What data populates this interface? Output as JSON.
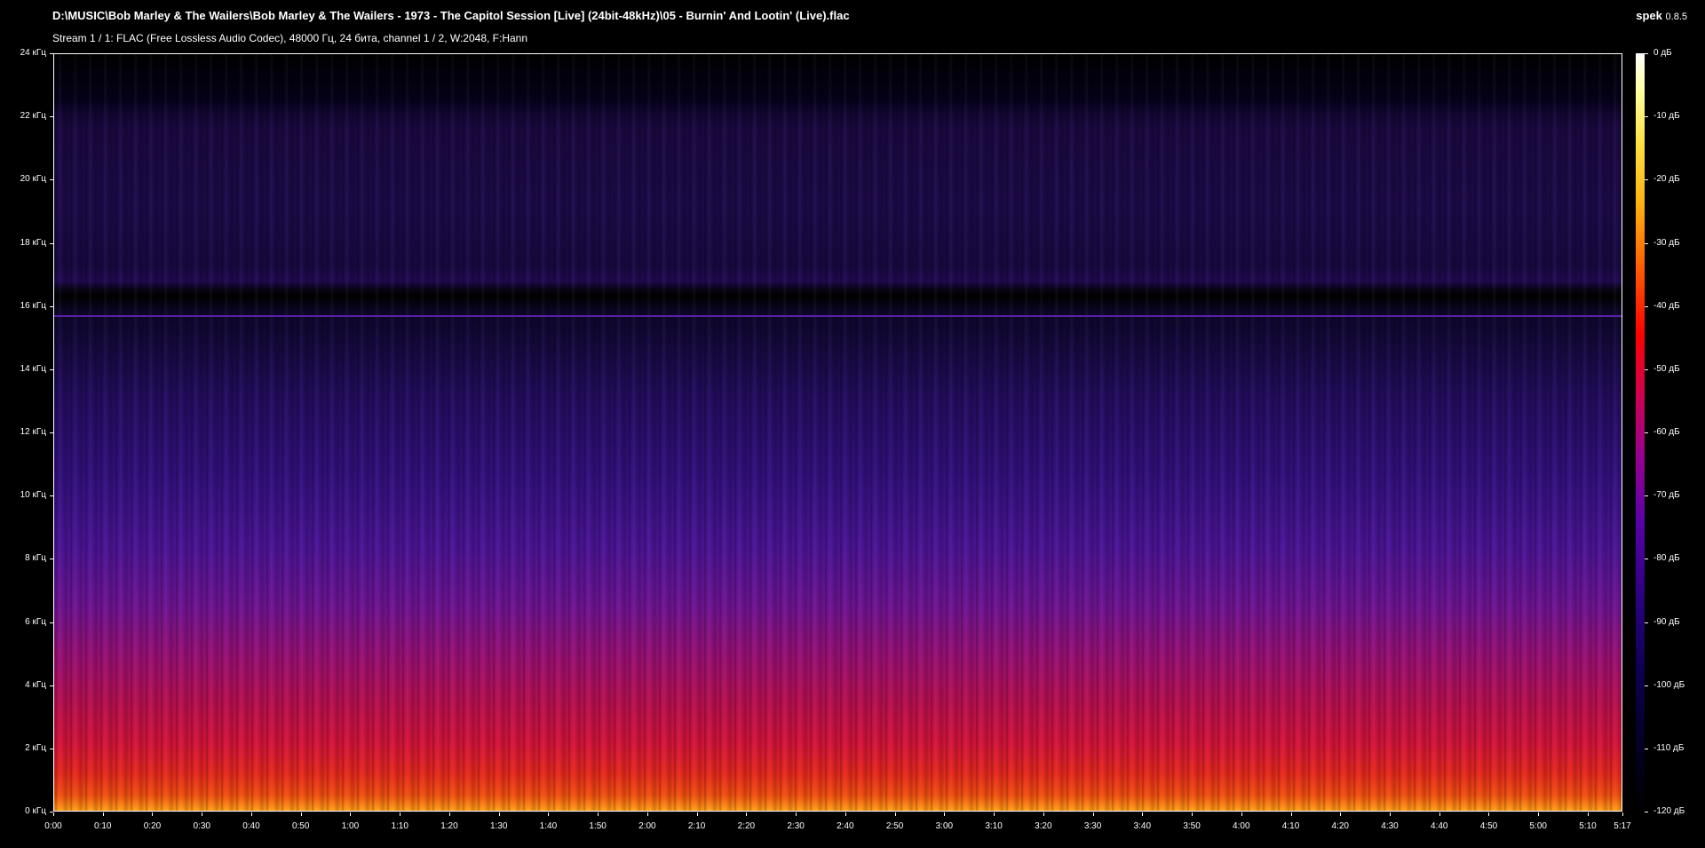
{
  "header": {
    "file_path": "D:\\MUSIC\\Bob Marley & The Wailers\\Bob Marley & The Wailers - 1973 - The Capitol Session [Live] (24bit-48kHz)\\05 - Burnin' And Lootin' (Live).flac",
    "stream_info": "Stream 1 / 1: FLAC (Free Lossless Audio Codec), 48000 Гц, 24 бита, channel 1 / 2, W:2048, F:Hann",
    "app_name": "spek",
    "app_version": "0.8.5"
  },
  "freq_axis": [
    "24 кГц",
    "22 кГц",
    "20 кГц",
    "18 кГц",
    "16 кГц",
    "14 кГц",
    "12 кГц",
    "10 кГц",
    "8 кГц",
    "6 кГц",
    "4 кГц",
    "2 кГц",
    "0 кГц"
  ],
  "time_axis": [
    "0:00",
    "0:10",
    "0:20",
    "0:30",
    "0:40",
    "0:50",
    "1:00",
    "1:10",
    "1:20",
    "1:30",
    "1:40",
    "1:50",
    "2:00",
    "2:10",
    "2:20",
    "2:30",
    "2:40",
    "2:50",
    "3:00",
    "3:10",
    "3:20",
    "3:30",
    "3:40",
    "3:50",
    "4:00",
    "4:10",
    "4:20",
    "4:30",
    "4:40",
    "4:50",
    "5:00",
    "5:10",
    "5:17"
  ],
  "db_axis": [
    "0 дБ",
    "-10 дБ",
    "-20 дБ",
    "-30 дБ",
    "-40 дБ",
    "-50 дБ",
    "-60 дБ",
    "-70 дБ",
    "-80 дБ",
    "-90 дБ",
    "-100 дБ",
    "-110 дБ",
    "-120 дБ"
  ],
  "colors": {
    "background": "#000000",
    "text": "#ffffff",
    "spectrogram_low": "#1c0a48",
    "spectrogram_high": "#e4281e"
  }
}
